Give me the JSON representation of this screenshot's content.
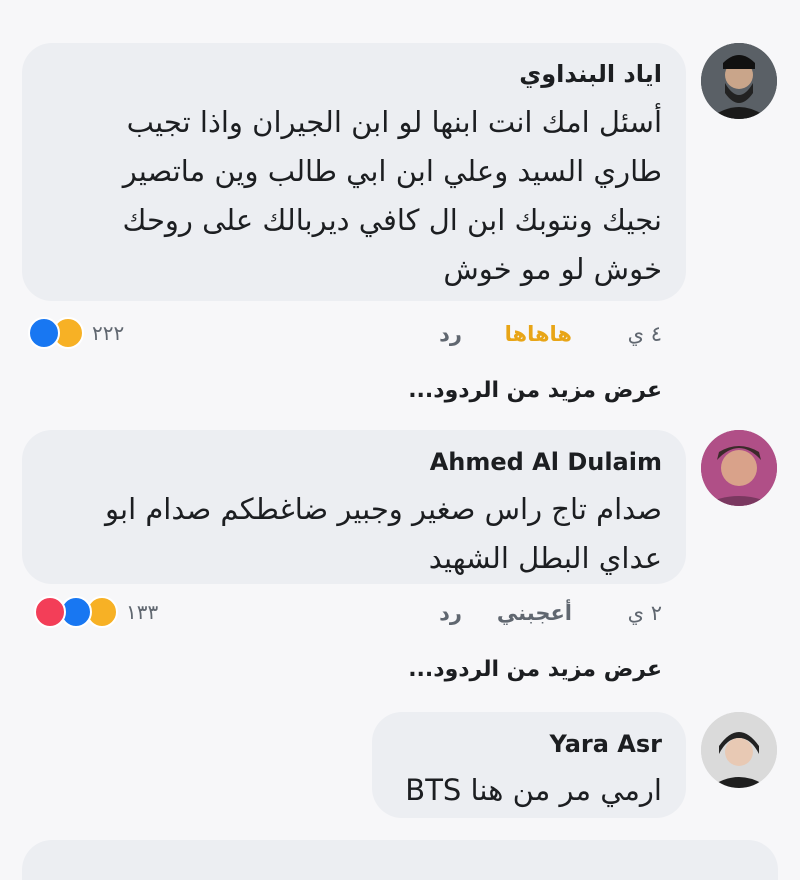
{
  "comments": [
    {
      "author": "اياد البنداوي",
      "lines": [
        "أسئل امك انت ابنها لو ابن الجيران واذا تجيب",
        "طاري السيد وعلي ابن ابي طالب وين ماتصير",
        "نجيك ونتوبك ابن ال كافي ديربالك على روحك",
        "خوش لو مو خوش"
      ],
      "time": "٤ ي",
      "reaction_label": "هاهاها",
      "reply": "رد",
      "reaction_count": "٢٢٢",
      "reaction_icons": [
        "like-icon",
        "haha-icon"
      ],
      "more_replies": "عرض مزيد من الردود..."
    },
    {
      "author": "Ahmed Al Dulaim",
      "lines": [
        "صدام تاج راس صغير وجبير ضاغطكم صدام ابو",
        "عداي البطل الشهيد"
      ],
      "time": "٢ ي",
      "reaction_label": "أعجبني",
      "reply": "رد",
      "reaction_count": "١٣٣",
      "reaction_icons": [
        "love-icon",
        "like-icon",
        "haha-icon"
      ],
      "more_replies": "عرض مزيد من الردود..."
    },
    {
      "author": "Yara Asr",
      "lines": [
        "ارمي مر من هنا BTS"
      ]
    }
  ],
  "colors": {
    "like": "#1877f2",
    "haha": "#f7b125",
    "love": "#f33e58",
    "bubble": "#eceef2",
    "haha_text": "#e8a517"
  }
}
